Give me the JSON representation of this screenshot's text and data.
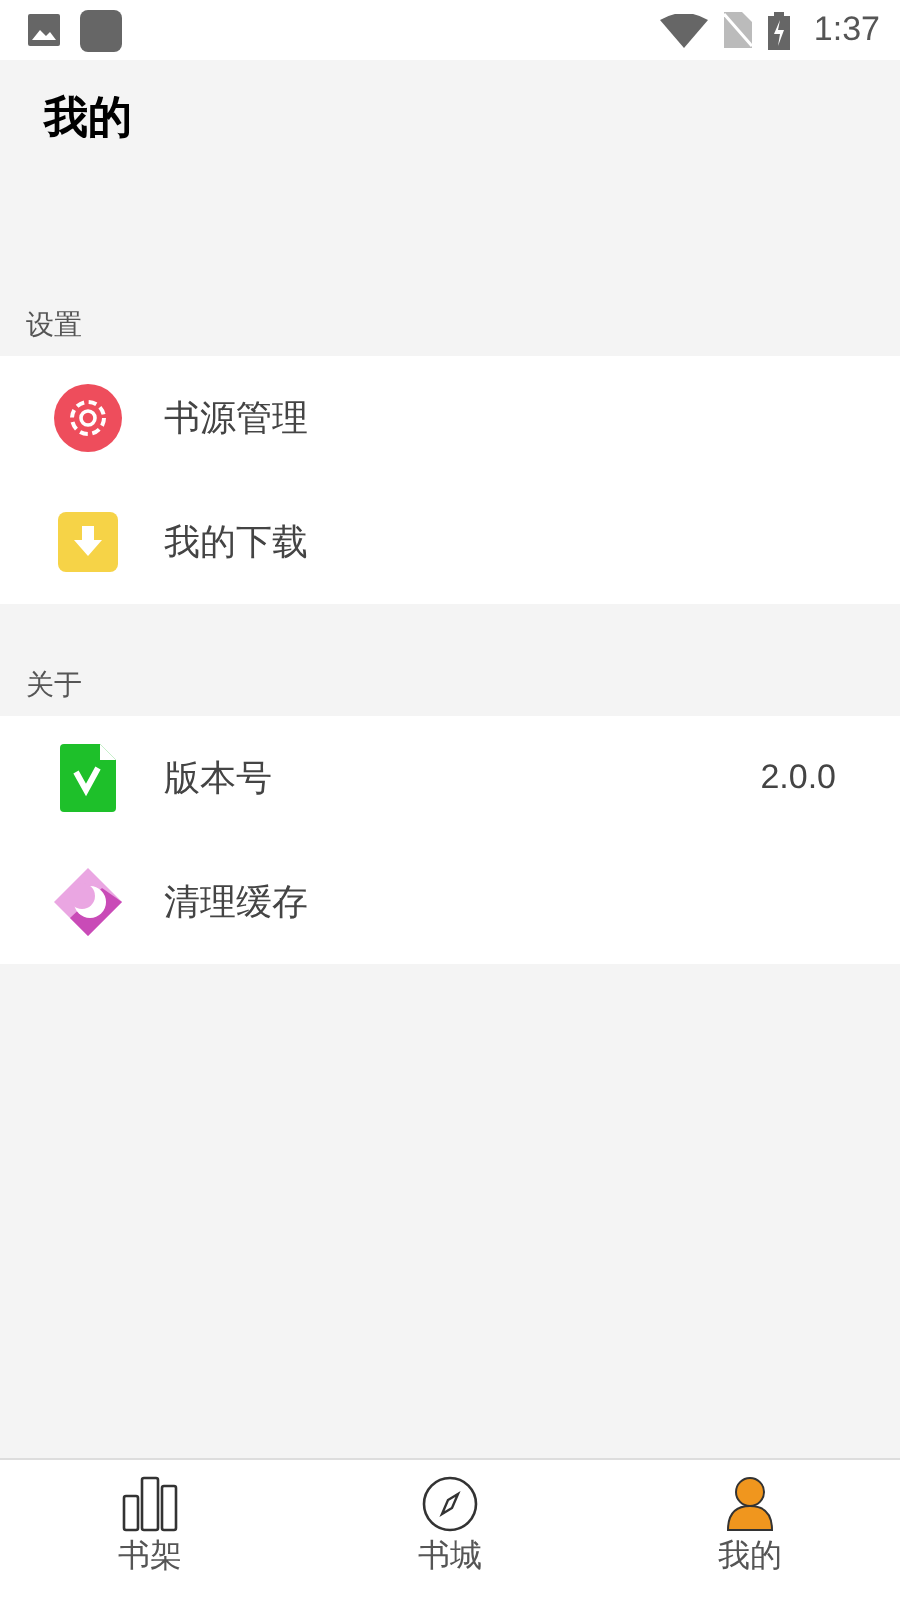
{
  "status_bar": {
    "time": "1:37"
  },
  "title": "我的",
  "sections": [
    {
      "label": "设置",
      "items": [
        {
          "label": "书源管理"
        },
        {
          "label": "我的下载"
        }
      ]
    },
    {
      "label": "关于",
      "items": [
        {
          "label": "版本号",
          "value": "2.0.0"
        },
        {
          "label": "清理缓存"
        }
      ]
    }
  ],
  "nav": [
    {
      "label": "书架",
      "selected": false
    },
    {
      "label": "书城",
      "selected": false
    },
    {
      "label": "我的",
      "selected": true
    }
  ]
}
